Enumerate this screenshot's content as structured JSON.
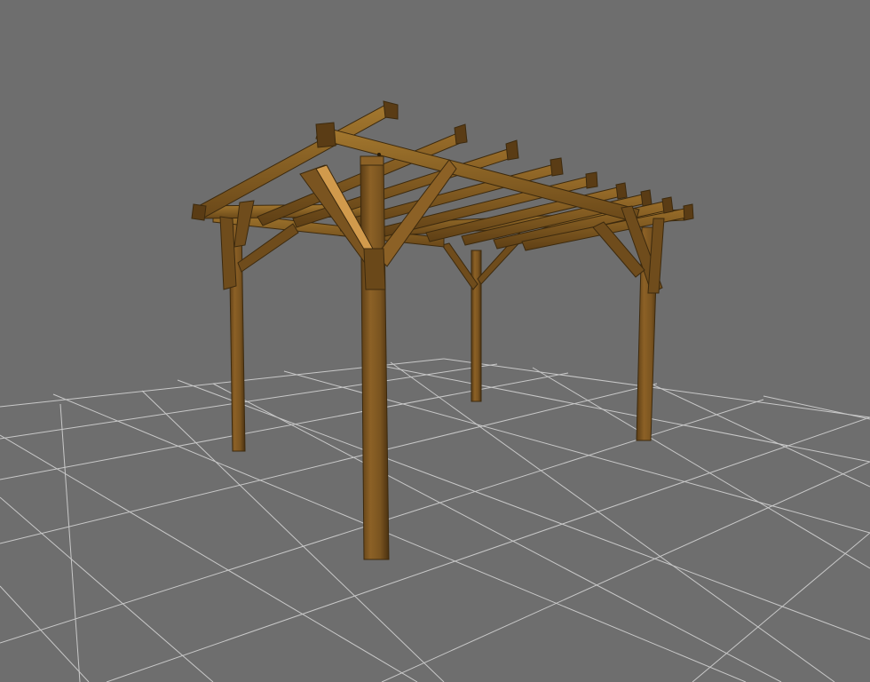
{
  "viewport": {
    "background_color": "#6e6e6e",
    "grid_color": "#d8d8d8",
    "show_grid": true
  },
  "model": {
    "object": "pergola",
    "wood_color": "#7a5420",
    "wood_light": "#a5792f",
    "wood_dark": "#4e3412",
    "wood_highlight": "#d19a4c"
  }
}
